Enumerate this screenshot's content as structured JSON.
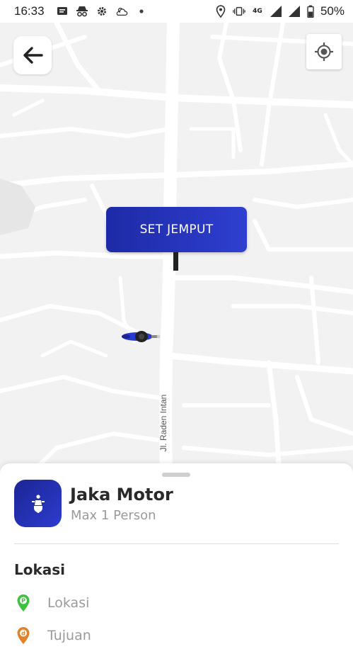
{
  "status_bar": {
    "time": "16:33",
    "network": "4G",
    "battery": "50%"
  },
  "map": {
    "road_label": "Jl. Raden Intan",
    "set_pickup_label": "SET JEMPUT"
  },
  "sheet": {
    "service_title": "Jaka Motor",
    "service_subtitle": "Max 1 Person",
    "section_title": "Lokasi",
    "pickup_label": "Lokasi",
    "destination_label": "Tujuan"
  },
  "colors": {
    "brand": "#2432b8",
    "pickup_pin": "#3cc23c",
    "destination_pin": "#e0822a"
  }
}
